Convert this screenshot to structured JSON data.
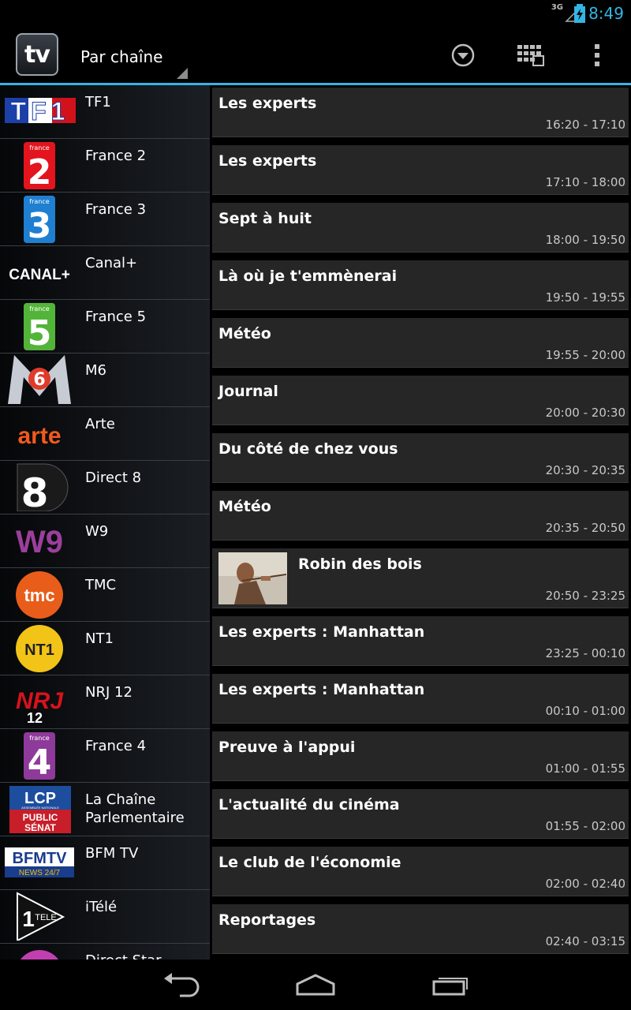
{
  "status_bar": {
    "network": "3G",
    "time": "8:49"
  },
  "action_bar": {
    "app_icon_text": "tv",
    "spinner_label": "Par chaîne",
    "accent_color": "#33b5e5"
  },
  "channels": [
    {
      "name": "TF1",
      "logo": "tf1-logo"
    },
    {
      "name": "France 2",
      "logo": "france2-logo"
    },
    {
      "name": "France 3",
      "logo": "france3-logo"
    },
    {
      "name": "Canal+",
      "logo": "canalplus-logo"
    },
    {
      "name": "France 5",
      "logo": "france5-logo"
    },
    {
      "name": "M6",
      "logo": "m6-logo"
    },
    {
      "name": "Arte",
      "logo": "arte-logo"
    },
    {
      "name": "Direct 8",
      "logo": "direct8-logo"
    },
    {
      "name": "W9",
      "logo": "w9-logo"
    },
    {
      "name": "TMC",
      "logo": "tmc-logo"
    },
    {
      "name": "NT1",
      "logo": "nt1-logo"
    },
    {
      "name": "NRJ 12",
      "logo": "nrj12-logo"
    },
    {
      "name": "France 4",
      "logo": "france4-logo"
    },
    {
      "name": "La Chaîne Parlementaire",
      "logo": "lcp-logo"
    },
    {
      "name": "BFM TV",
      "logo": "bfmtv-logo"
    },
    {
      "name": "iTélé",
      "logo": "itele-logo"
    },
    {
      "name": "Direct Star",
      "logo": "directstar-logo"
    }
  ],
  "logo_text": {
    "tf1": "TF1",
    "france": "france",
    "canal": "CANAL+",
    "m6": "M6",
    "arte": "arte",
    "direct8": "8",
    "w9": "W9",
    "tmc": "tmc",
    "nt1": "NT1",
    "nrj": "NRJ",
    "nrj12": "12",
    "lcp": "LCP",
    "lcp_sub": "ASSEMBLÉE NATIONALE",
    "public": "PUBLIC",
    "senat": "SÉNAT",
    "bfm": "BFMTV",
    "news": "NEWS 24/7",
    "itele": "TELE",
    "itele_one": "1"
  },
  "programs": [
    {
      "title": "Les experts",
      "time": "16:20 - 17:10"
    },
    {
      "title": "Les experts",
      "time": "17:10 - 18:00"
    },
    {
      "title": "Sept à huit",
      "time": "18:00 - 19:50"
    },
    {
      "title": "Là où je t'emmènerai",
      "time": "19:50 - 19:55"
    },
    {
      "title": "Météo",
      "time": "19:55 - 20:00"
    },
    {
      "title": "Journal",
      "time": "20:00 - 20:30"
    },
    {
      "title": "Du côté de chez vous",
      "time": "20:30 - 20:35"
    },
    {
      "title": "Météo",
      "time": "20:35 - 20:50"
    },
    {
      "title": "Robin des bois",
      "time": "20:50 - 23:25",
      "has_thumbnail": true
    },
    {
      "title": "Les experts : Manhattan",
      "time": "23:25 - 00:10"
    },
    {
      "title": "Les experts : Manhattan",
      "time": "00:10 - 01:00"
    },
    {
      "title": "Preuve à l'appui",
      "time": "01:00 - 01:55"
    },
    {
      "title": "L'actualité du cinéma",
      "time": "01:55 - 02:00"
    },
    {
      "title": "Le club de l'économie",
      "time": "02:00 - 02:40"
    },
    {
      "title": "Reportages",
      "time": "02:40 - 03:15"
    }
  ],
  "nav_bar": {
    "back": "back-icon",
    "home": "home-icon",
    "recents": "recents-icon"
  }
}
